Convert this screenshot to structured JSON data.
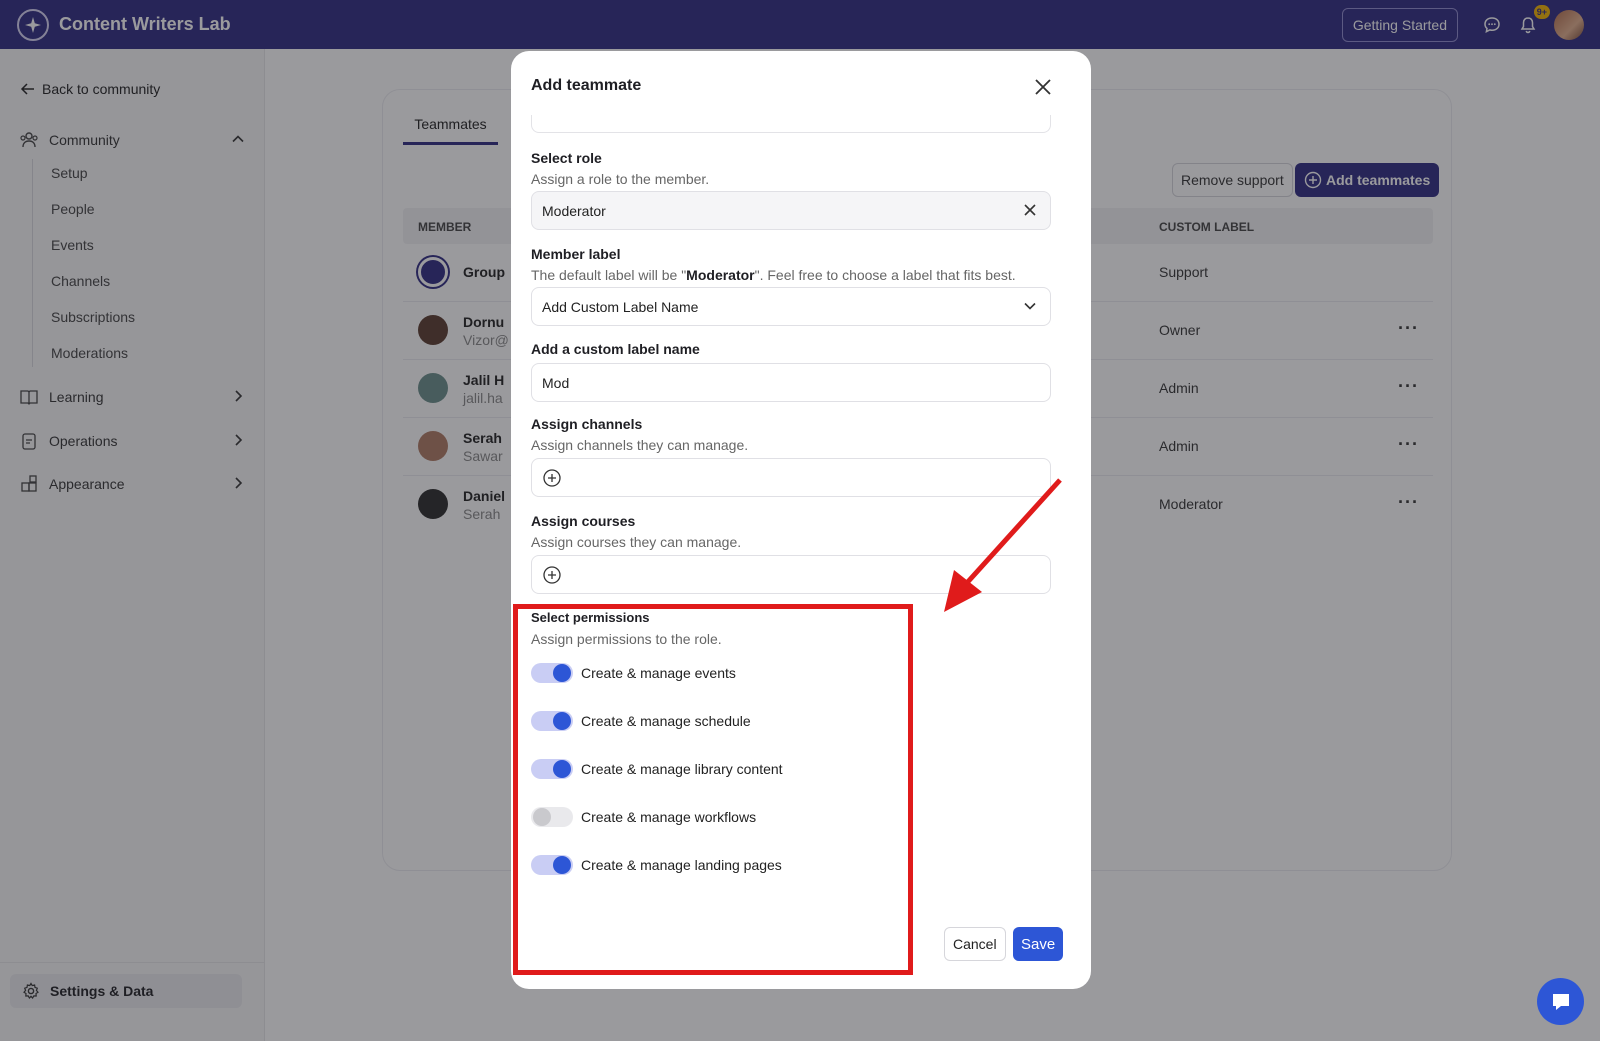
{
  "app": {
    "title": "Content Writers Lab",
    "getting_started": "Getting Started",
    "notification_badge": "9+",
    "accent_color": "#2f2a82",
    "primary_color": "#2d56d6"
  },
  "sidebar": {
    "back": "Back to community",
    "community": "Community",
    "community_items": [
      "Setup",
      "People",
      "Events",
      "Channels",
      "Subscriptions",
      "Moderations"
    ],
    "learning": "Learning",
    "operations": "Operations",
    "appearance": "Appearance",
    "settings": "Settings & Data"
  },
  "main": {
    "tab": "Teammates",
    "remove_support": "Remove support",
    "add_teammates": "Add teammates",
    "col_member": "MEMBER",
    "col_custom_label": "CUSTOM LABEL",
    "rows": [
      {
        "name": "Group",
        "email": "",
        "label": "Support"
      },
      {
        "name": "Dornu",
        "email": "Vizor@",
        "label": "Owner"
      },
      {
        "name": "Jalil H",
        "email": "jalil.ha",
        "label": "Admin"
      },
      {
        "name": "Serah",
        "email": "Sawar",
        "label": "Admin"
      },
      {
        "name": "Daniel",
        "email": "Serah",
        "label": "Moderator"
      }
    ]
  },
  "modal": {
    "title": "Add teammate",
    "select_role_label": "Select role",
    "select_role_help": "Assign a role to the member.",
    "select_role_value": "Moderator",
    "member_label_label": "Member label",
    "member_label_help_prefix": "The default label will be \"",
    "member_label_help_role": "Moderator",
    "member_label_help_suffix": "\". Feel free to choose a label that fits best.",
    "member_label_value": "Add Custom Label Name",
    "custom_label_label": "Add a custom label name",
    "custom_label_value": "Mod",
    "channels_label": "Assign channels",
    "channels_help": "Assign channels they can manage.",
    "courses_label": "Assign courses",
    "courses_help": "Assign courses they can manage.",
    "permissions_label": "Select permissions",
    "permissions_help": "Assign permissions to the role.",
    "permissions": [
      {
        "label": "Create & manage events",
        "enabled": true
      },
      {
        "label": "Create & manage schedule",
        "enabled": true
      },
      {
        "label": "Create & manage library content",
        "enabled": true
      },
      {
        "label": "Create & manage workflows",
        "enabled": false
      },
      {
        "label": "Create & manage landing pages",
        "enabled": true
      }
    ],
    "cancel": "Cancel",
    "save": "Save"
  },
  "annotation": {
    "color": "#e01b1b"
  }
}
